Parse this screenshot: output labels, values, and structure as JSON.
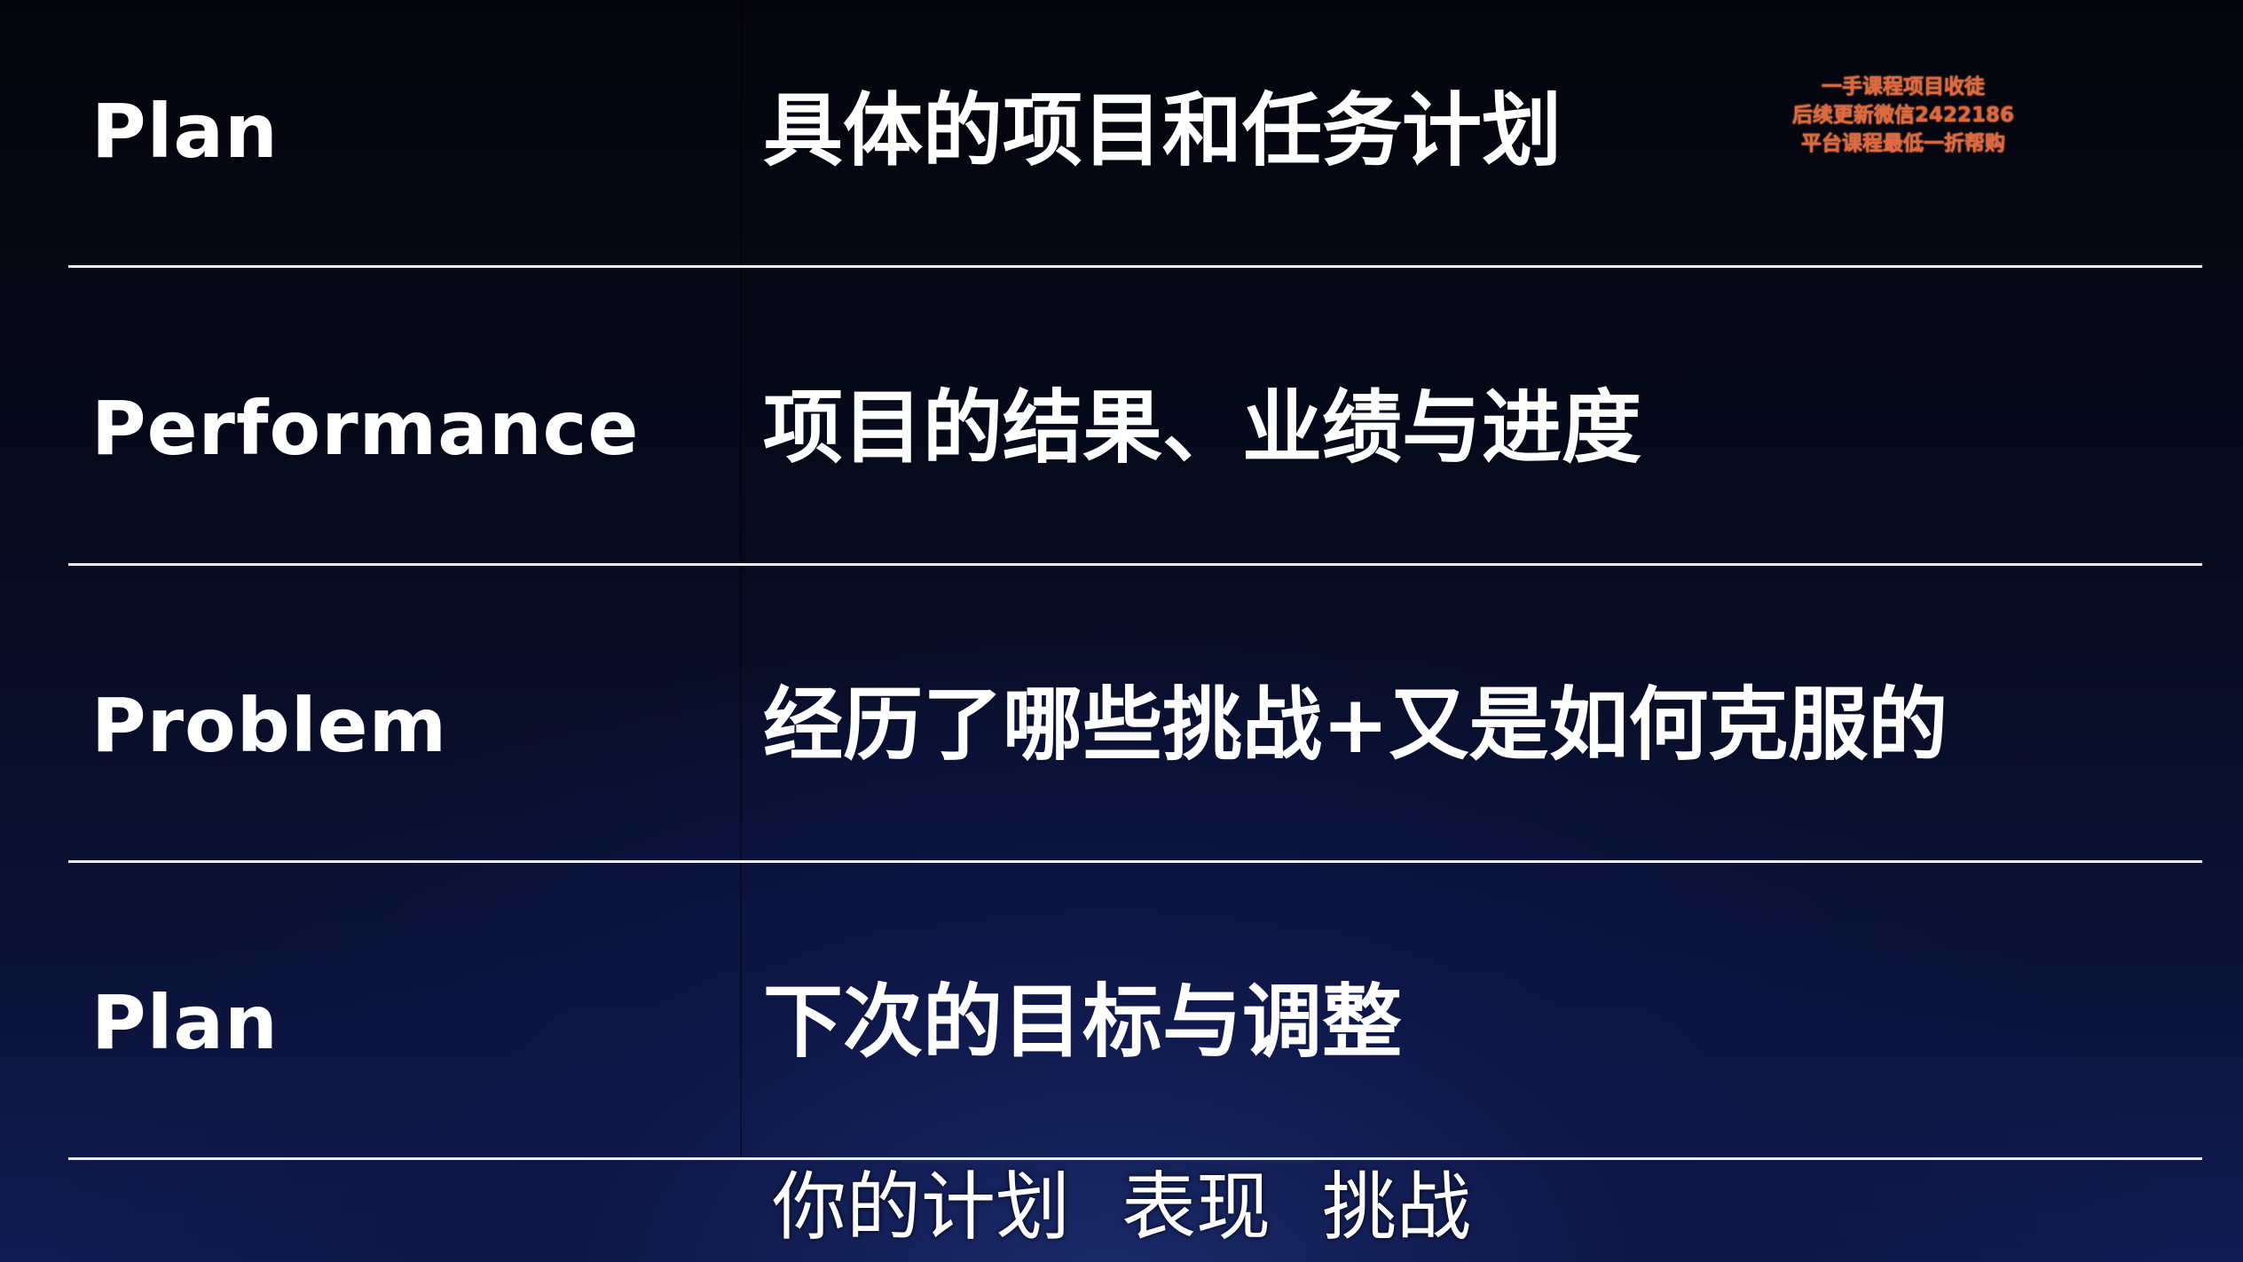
{
  "rows": [
    {
      "term": "Plan",
      "description": "具体的项目和任务计划"
    },
    {
      "term": "Performance",
      "description": "项目的结果、业绩与进度"
    },
    {
      "term": "Problem",
      "description": "经历了哪些挑战+又是如何克服的"
    },
    {
      "term": "Plan",
      "description": "下次的目标与调整"
    }
  ],
  "watermark": {
    "line1": "一手课程项目收徒",
    "line2": "后续更新微信2422186",
    "line3": "平台课程最低一折帮购"
  },
  "subtitle": {
    "part1": "你的计划",
    "part2": "表现",
    "part3": "挑战"
  },
  "colors": {
    "text": "#ffffff",
    "divider": "#e9ecf4",
    "watermark": "#e2683c",
    "background_top": "#04050c",
    "background_bottom": "#101b52"
  }
}
